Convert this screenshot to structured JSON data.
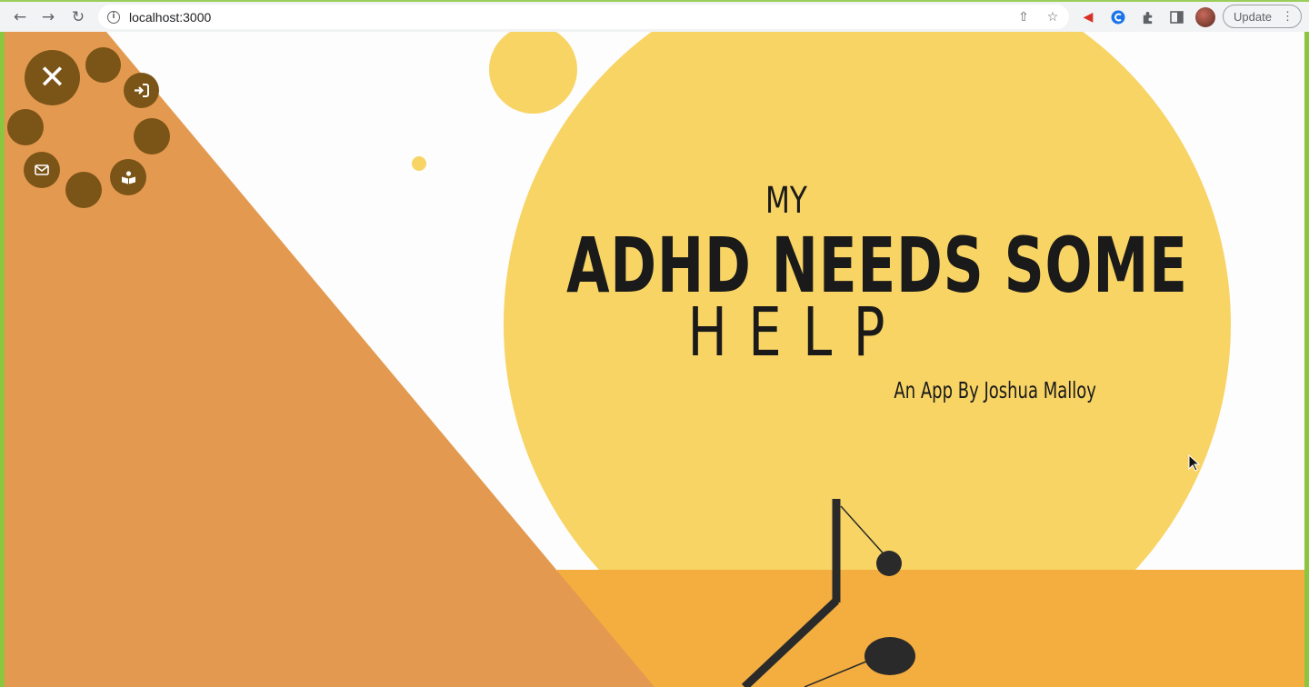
{
  "browser": {
    "url": "localhost:3000",
    "update_label": "Update",
    "icons": [
      "back-icon",
      "forward-icon",
      "reload-icon",
      "info-icon",
      "share-icon",
      "bookmark-star-icon",
      "megaphone-extension-icon",
      "grammar-extension-icon",
      "puzzle-extensions-icon",
      "sidebar-icon",
      "profile-avatar",
      "kebab-menu-icon"
    ]
  },
  "hero": {
    "pre": "MY",
    "title": "ADHD NEEDS SOME",
    "help": "HELP",
    "subtitle": "An App By Joshua Malloy"
  },
  "menu": {
    "items": [
      {
        "name": "close",
        "icon": "close-icon",
        "glyph": "✕"
      },
      {
        "name": "login",
        "icon": "sign-in-icon"
      },
      {
        "name": "contact",
        "icon": "envelope-icon"
      },
      {
        "name": "read",
        "icon": "book-reader-icon"
      }
    ]
  },
  "colors": {
    "triangle": "#e39a50",
    "sun": "#f8d465",
    "ground": "#f4ae40",
    "menu": "#7b5417",
    "text": "#1a1a1a",
    "browser_frame": "#8cc63f"
  }
}
